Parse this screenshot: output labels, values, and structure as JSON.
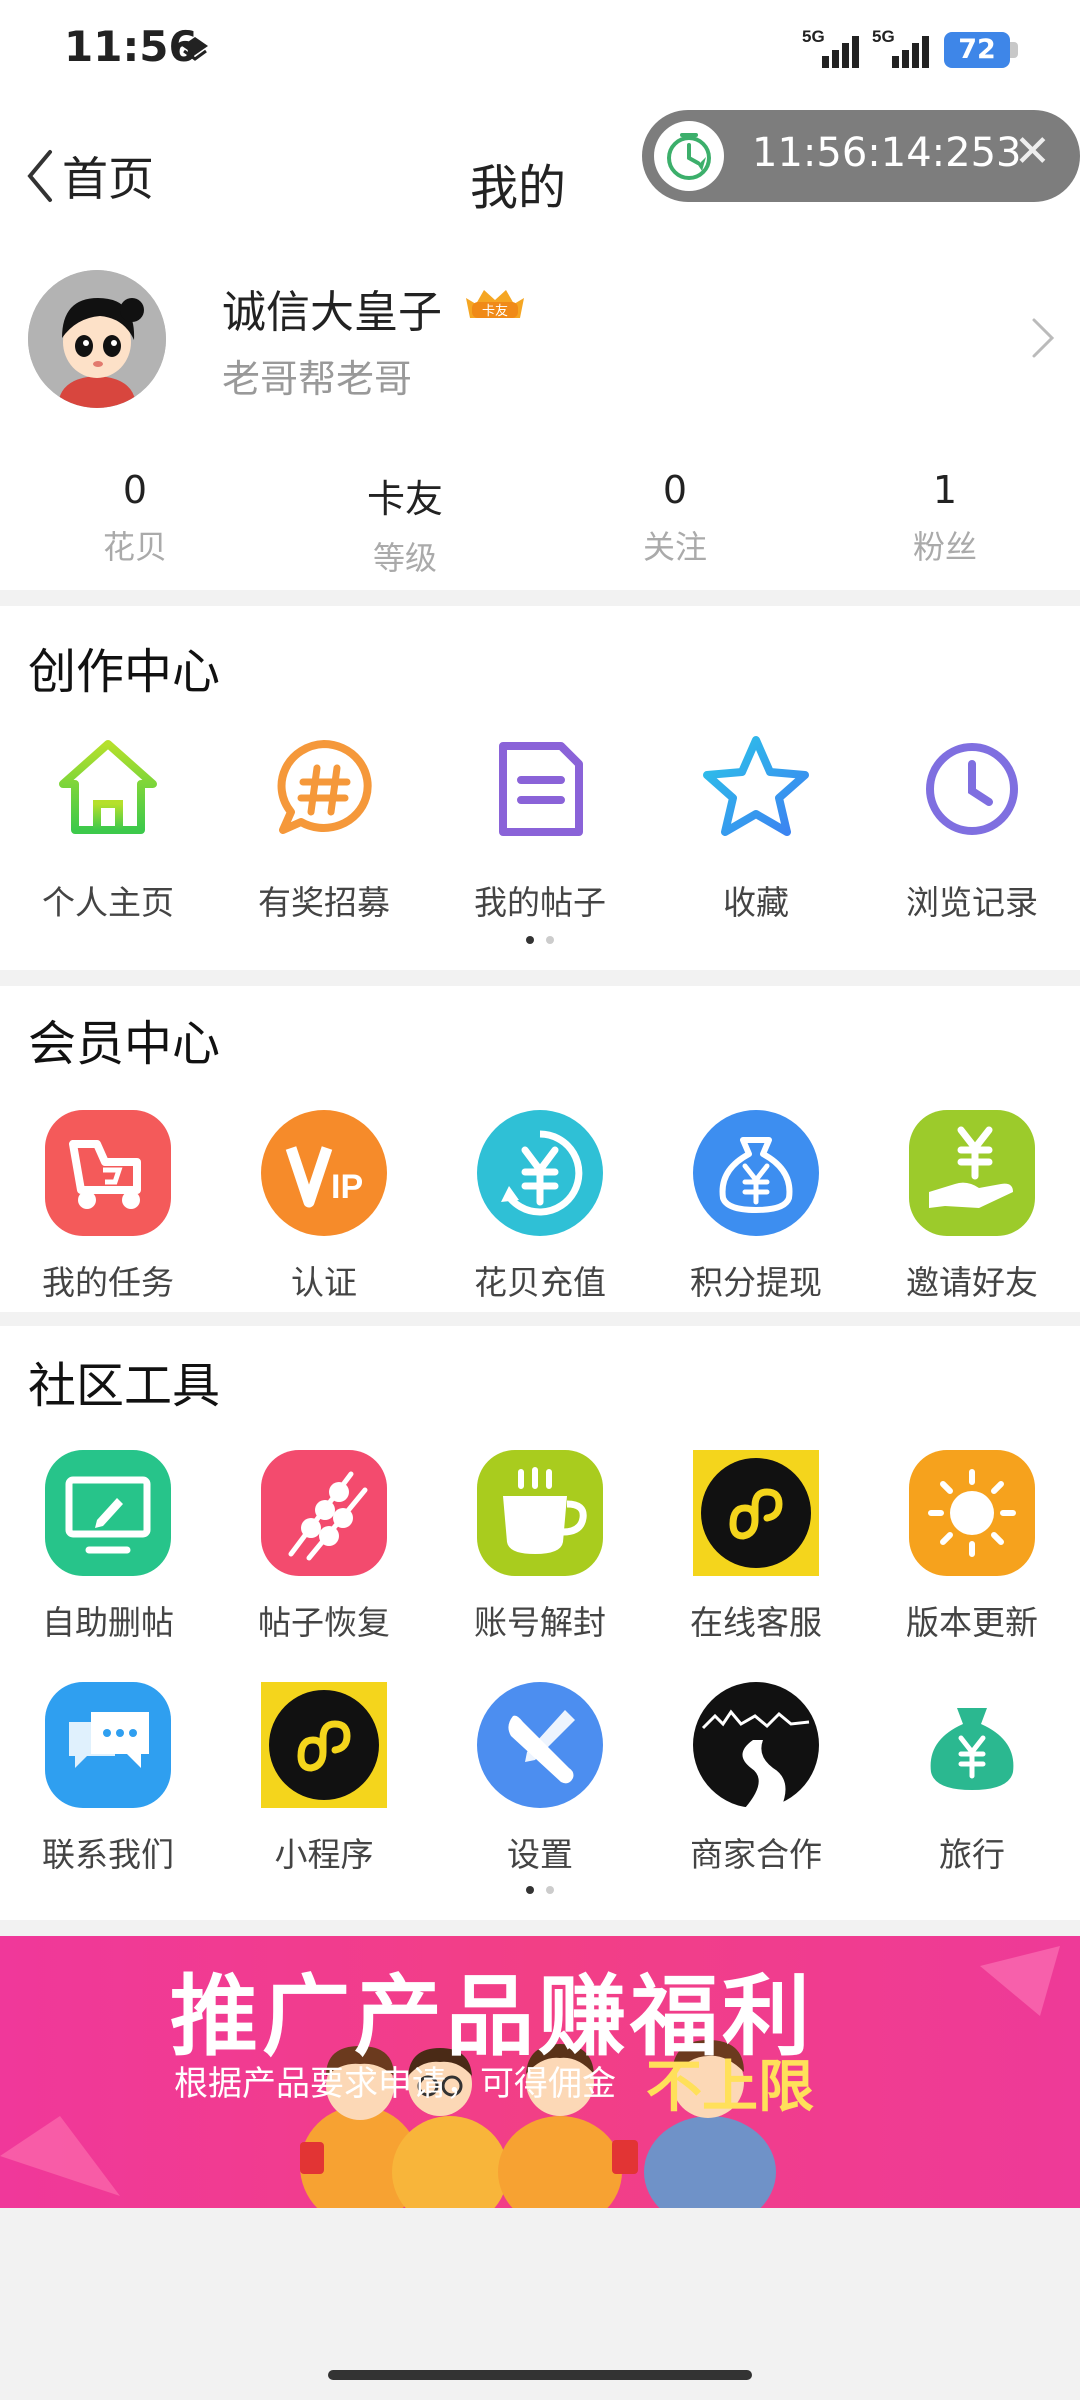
{
  "status_bar": {
    "time": "11:56",
    "signal_labels": [
      "5G",
      "5G"
    ],
    "battery": "72"
  },
  "nav": {
    "back_label": "首页",
    "title": "我的"
  },
  "timer": {
    "text": "11:56:14:253",
    "close": "✕"
  },
  "profile": {
    "name": "诚信大皇子",
    "badge": "卡友",
    "subtitle": "老哥帮老哥",
    "stats": [
      {
        "value": "0",
        "label": "花贝"
      },
      {
        "value": "卡友",
        "label": "等级"
      },
      {
        "value": "0",
        "label": "关注"
      },
      {
        "value": "1",
        "label": "粉丝"
      }
    ]
  },
  "creation_center": {
    "title": "创作中心",
    "items": [
      {
        "label": "个人主页",
        "icon": "house-icon"
      },
      {
        "label": "有奖招募",
        "icon": "hashtag-bubble-icon"
      },
      {
        "label": "我的帖子",
        "icon": "document-icon"
      },
      {
        "label": "收藏",
        "icon": "star-icon"
      },
      {
        "label": "浏览记录",
        "icon": "clock-icon"
      }
    ]
  },
  "member_center": {
    "title": "会员中心",
    "items": [
      {
        "label": "我的任务",
        "icon": "scooter-icon",
        "color": "#f45a5a"
      },
      {
        "label": "认证",
        "icon": "vip-icon",
        "color": "#f68b2a"
      },
      {
        "label": "花贝充值",
        "icon": "yuan-refresh-icon",
        "color": "#2fc0d6"
      },
      {
        "label": "积分提现",
        "icon": "money-bag-icon",
        "color": "#3d8ef0"
      },
      {
        "label": "邀请好友",
        "icon": "hand-yuan-icon",
        "color": "#9ccb2b"
      }
    ]
  },
  "community_tools": {
    "title": "社区工具",
    "items": [
      {
        "label": "自助删帖",
        "icon": "monitor-edit-icon",
        "color": "#27c48a"
      },
      {
        "label": "帖子恢复",
        "icon": "skewers-icon",
        "color": "#f34b6e"
      },
      {
        "label": "账号解封",
        "icon": "coffee-cup-icon",
        "color": "#a9cc1e"
      },
      {
        "label": "在线客服",
        "icon": "mini-program-icon",
        "color": "#f4d51c"
      },
      {
        "label": "版本更新",
        "icon": "sun-icon",
        "color": "#f6a21d"
      },
      {
        "label": "联系我们",
        "icon": "chat-bubbles-icon",
        "color": "#2f9ff0"
      },
      {
        "label": "小程序",
        "icon": "mini-program-icon",
        "color": "#f4d51c"
      },
      {
        "label": "设置",
        "icon": "wrench-screwdriver-icon",
        "color": "#4c8ef0"
      },
      {
        "label": "商家合作",
        "icon": "road-mountain-icon",
        "color": "#111111"
      },
      {
        "label": "旅行",
        "icon": "money-bag-icon",
        "color": "#2bb890"
      }
    ]
  },
  "banner": {
    "title": "推广产品赚福利",
    "subtitle": "根据产品要求申请，可得佣金",
    "accent": "不上限"
  }
}
